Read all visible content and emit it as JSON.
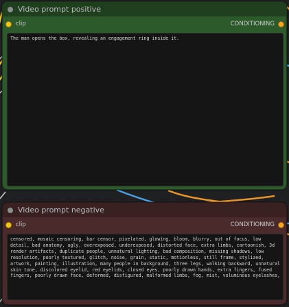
{
  "nodes": {
    "positive": {
      "title": "Video prompt positive",
      "input_label": "clip",
      "output_label": "CONDITIONING",
      "text": "The man opens the box, revealing an engagement ring inside it."
    },
    "negative": {
      "title": "Video prompt negative",
      "input_label": "clip",
      "output_label": "CONDITIONING",
      "text": "censored, mosaic censoring, bar censor, pixelated, glowing, bloom, blurry, out of focus, low detail, bad anatomy, ugly, overexposed, underexposed, distorted face, extra limbs, cartoonish, 3d render artifacts, duplicate people, unnatural lighting, bad composition, missing shadows, low resolution, poorly textured, glitch, noise, grain, static, motionless, still frame, stylized, artwork, painting, illustration, many people in background, three legs, walking backward, unnatural skin tone, discolored eyelid, red eyelids, closed eyes, poorly drawn hands, extra fingers, fused fingers, poorly drawn face, deformed, disfigured, malformed limbs, fog, mist, voluminous eyelashes,"
    }
  },
  "colors": {
    "positive_node": "#2d5a2b",
    "negative_node": "#4a2a2a",
    "clip_slot": "#f5c518",
    "conditioning_slot": "#f5a623",
    "wire_blue": "#4a9fe0",
    "wire_orange": "#e8962a"
  }
}
